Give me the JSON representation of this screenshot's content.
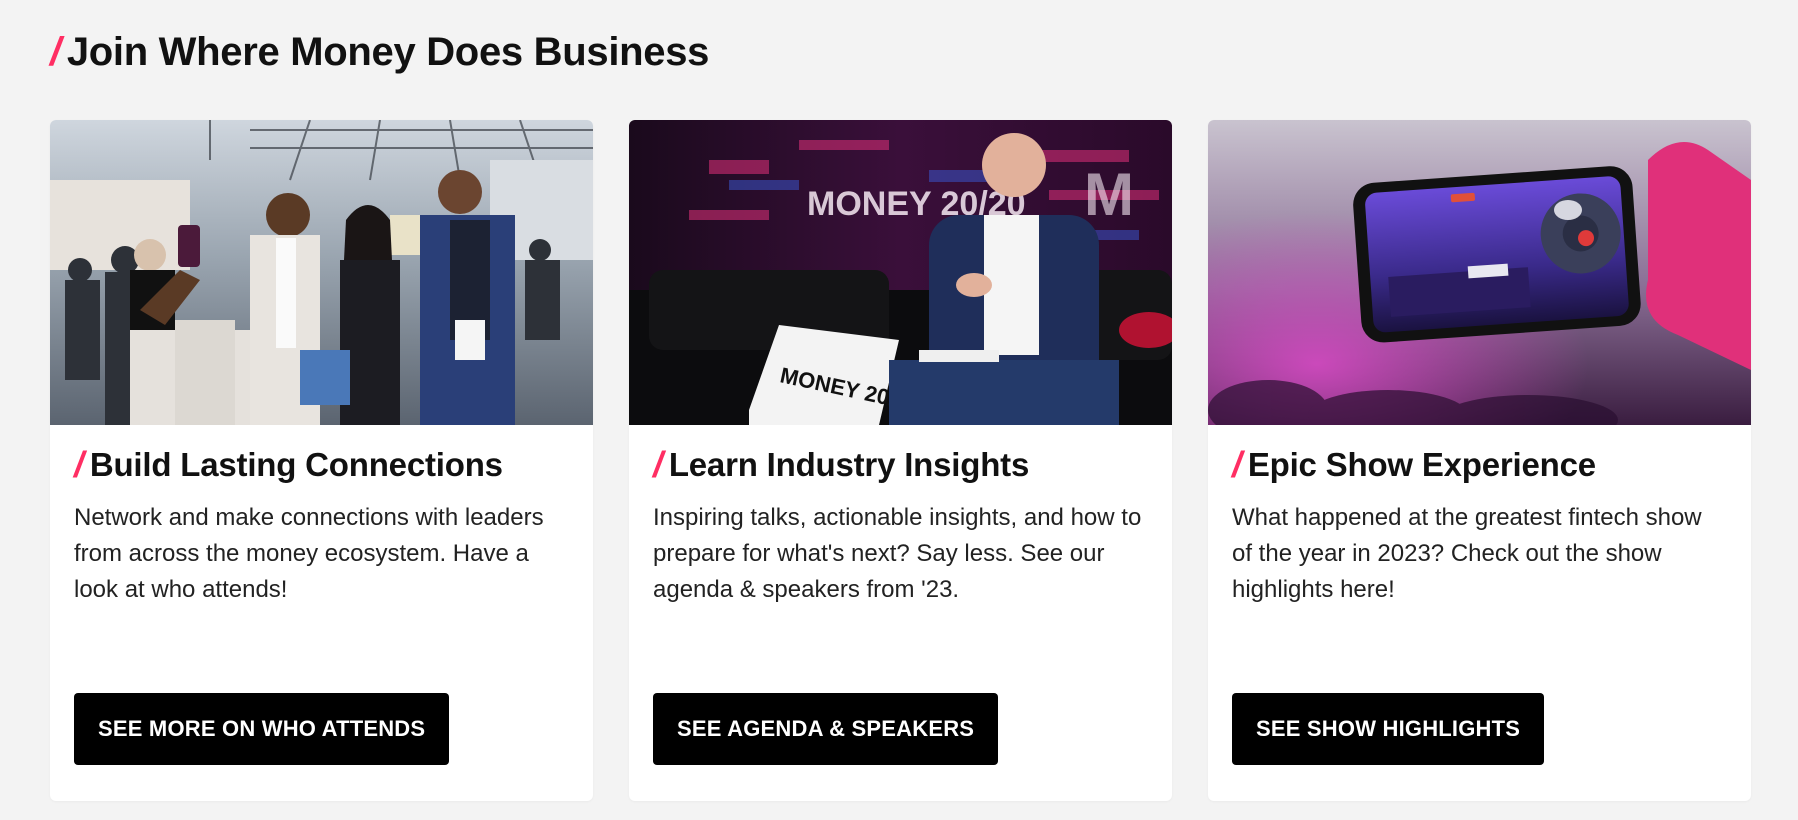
{
  "section": {
    "title": "Join Where Money Does Business",
    "slash": "/"
  },
  "accent_color": "#ff2e63",
  "cards": [
    {
      "image_alt": "Attendees taking a selfie on the expo floor",
      "slash": "/",
      "title": "Build Lasting Connections",
      "description": "Network and make connections with leaders from across the money ecosystem. Have a look at who attends!",
      "button_label": "SEE MORE ON WHO ATTENDS"
    },
    {
      "image_alt": "Speaker seated on stage with MONEY 20/20 pillow",
      "slash": "/",
      "title": "Learn Industry Insights",
      "description": "Inspiring talks, actionable insights, and how to prepare for what's next? Say less. See our agenda & speakers from '23.",
      "button_label": "SEE AGENDA & SPEAKERS"
    },
    {
      "image_alt": "Hand holding phone recording the main stage",
      "slash": "/",
      "title": "Epic Show Experience",
      "description": "What happened at the greatest fintech show of the year in 2023? Check out the show highlights here!",
      "button_label": "SEE SHOW HIGHLIGHTS"
    }
  ],
  "image_text": {
    "stage_logo": "MONEY 20/20",
    "pillow_logo": "MONEY 20/20"
  }
}
